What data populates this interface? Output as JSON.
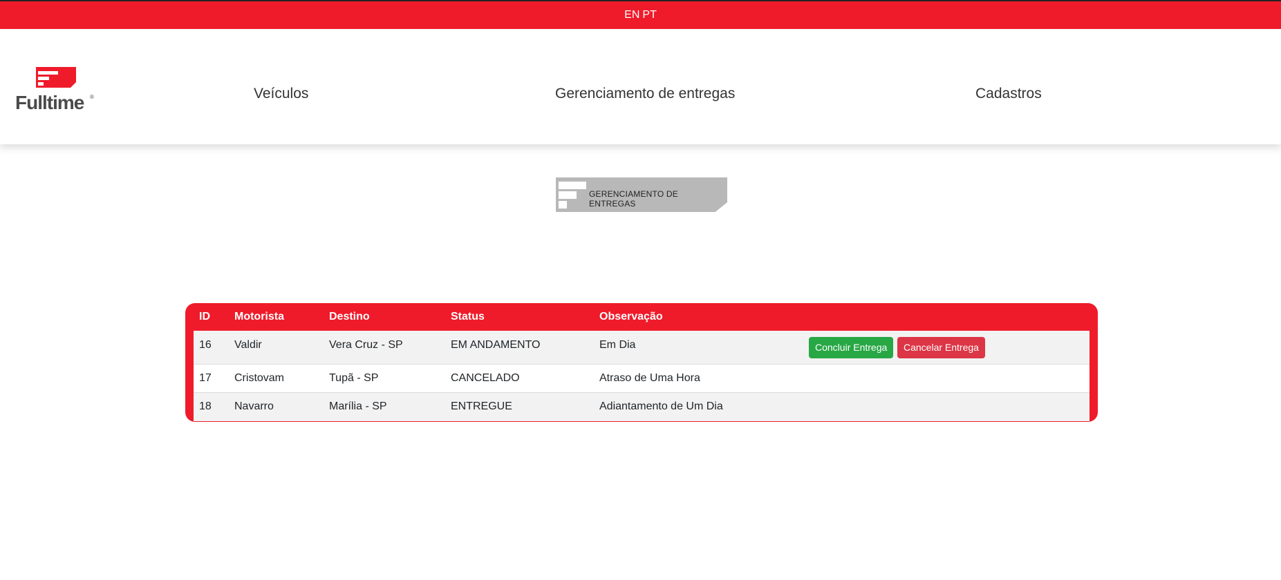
{
  "topbar": {
    "lang_en": "EN",
    "lang_pt": "PT"
  },
  "brand": {
    "name": "Fulltime",
    "mark": "®",
    "color": "#ef1b2a"
  },
  "nav": {
    "items": [
      {
        "label": "Veículos"
      },
      {
        "label": "Gerenciamento de entregas"
      },
      {
        "label": "Cadastros"
      }
    ]
  },
  "banner": {
    "text": "GERENCIAMENTO DE ENTREGAS"
  },
  "table": {
    "headers": [
      "ID",
      "Motorista",
      "Destino",
      "Status",
      "Observação"
    ],
    "rows": [
      {
        "id": "16",
        "motorista": "Valdir",
        "destino": "Vera Cruz - SP",
        "status": "EM ANDAMENTO",
        "observacao": "Em Dia",
        "actions": {
          "conclude": "Concluir Entrega",
          "cancel": "Cancelar Entrega"
        }
      },
      {
        "id": "17",
        "motorista": "Cristovam",
        "destino": "Tupã - SP",
        "status": "CANCELADO",
        "observacao": "Atraso de Uma Hora"
      },
      {
        "id": "18",
        "motorista": "Navarro",
        "destino": "Marília - SP",
        "status": "ENTREGUE",
        "observacao": "Adiantamento de Um Dia"
      }
    ]
  },
  "colors": {
    "accent": "#ef1b2a",
    "success": "#28a745",
    "danger": "#dc3545"
  }
}
